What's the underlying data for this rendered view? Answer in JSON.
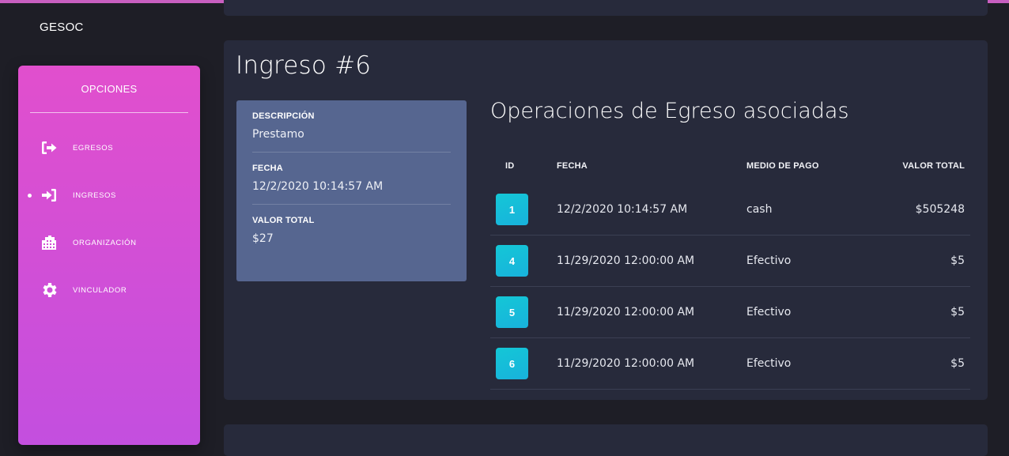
{
  "brand": "GESOC",
  "sidebar": {
    "title": "OPCIONES",
    "items": [
      {
        "label": "EGRESOS",
        "icon": "sign-out-icon",
        "active": false
      },
      {
        "label": "INGRESOS",
        "icon": "sign-in-icon",
        "active": true
      },
      {
        "label": "ORGANIZACIÓN",
        "icon": "building-icon",
        "active": false
      },
      {
        "label": "VINCULADOR",
        "icon": "gear-icon",
        "active": false
      }
    ]
  },
  "main": {
    "title": "Ingreso #6",
    "info": {
      "descripcion_label": "DESCRIPCIÓN",
      "descripcion_value": "Prestamo",
      "fecha_label": "FECHA",
      "fecha_value": "12/2/2020 10:14:57 AM",
      "valor_label": "VALOR TOTAL",
      "valor_value": "$27"
    },
    "operaciones": {
      "title": "Operaciones de Egreso asociadas",
      "headers": [
        "ID",
        "FECHA",
        "MEDIO DE PAGO",
        "VALOR TOTAL"
      ],
      "rows": [
        {
          "id": "1",
          "fecha": "12/2/2020 10:14:57 AM",
          "medio": "cash",
          "valor": "$505248"
        },
        {
          "id": "4",
          "fecha": "11/29/2020 12:00:00 AM",
          "medio": "Efectivo",
          "valor": "$5"
        },
        {
          "id": "5",
          "fecha": "11/29/2020 12:00:00 AM",
          "medio": "Efectivo",
          "valor": "$5"
        },
        {
          "id": "6",
          "fecha": "11/29/2020 12:00:00 AM",
          "medio": "Efectivo",
          "valor": "$5"
        }
      ]
    }
  },
  "colors": {
    "sidebar_top": "#e14fcd",
    "sidebar_bottom": "#c34fdf",
    "panel": "#566690",
    "card": "#272a3b",
    "badge": "#14c7d6"
  }
}
